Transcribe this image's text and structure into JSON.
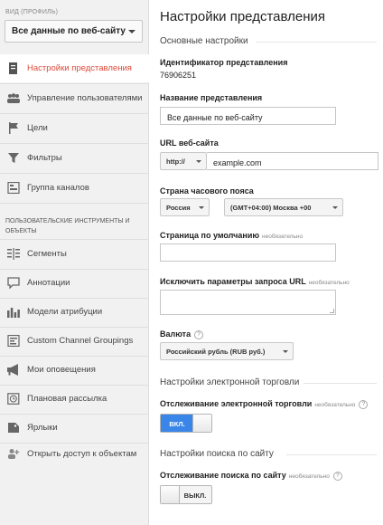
{
  "sidebar": {
    "view_label": "ВИД (ПРОФИЛЬ)",
    "view_select": "Все данные по веб-сайту",
    "items": [
      {
        "label": "Настройки представления",
        "icon": "settings-doc-icon",
        "active": true
      },
      {
        "label": "Управление пользователями",
        "icon": "users-icon"
      },
      {
        "label": "Цели",
        "icon": "flag-icon"
      },
      {
        "label": "Фильтры",
        "icon": "filter-icon"
      },
      {
        "label": "Группа каналов",
        "icon": "channel-group-icon"
      }
    ],
    "tools_heading": "ПОЛЬЗОВАТЕЛЬСКИЕ ИНСТРУМЕНТЫ И ОБЪЕКТЫ",
    "tools": [
      {
        "label": "Сегменты",
        "icon": "segments-icon"
      },
      {
        "label": "Аннотации",
        "icon": "annotation-icon"
      },
      {
        "label": "Модели атрибуции",
        "icon": "bar-chart-icon"
      },
      {
        "label": "Custom Channel Groupings",
        "icon": "custom-channel-icon"
      },
      {
        "label": "Мои оповещения",
        "icon": "megaphone-icon"
      },
      {
        "label": "Плановая рассылка",
        "icon": "clock-icon"
      },
      {
        "label": "Ярлыки",
        "icon": "shortcut-icon"
      },
      {
        "label": "Открыть доступ к объектам",
        "icon": "share-objects-icon"
      }
    ]
  },
  "main": {
    "title": "Настройки представления",
    "basic_heading": "Основные настройки",
    "view_id_label": "Идентификатор представления",
    "view_id_value": "76906251",
    "view_name_label": "Название представления",
    "view_name_value": "Все данные по веб-сайту",
    "url_label": "URL веб-сайта",
    "url_protocol": "http://",
    "url_value": "example.com",
    "timezone_label": "Страна часового пояса",
    "timezone_country": "Россия",
    "timezone_value": "(GMT+04:00) Москва +00",
    "default_page_label": "Страница по умолчанию",
    "optional": "необязательно",
    "exclude_params_label": "Исключить параметры запроса URL",
    "currency_label": "Валюта",
    "currency_value": "Российский рубль (RUB руб.)",
    "ecommerce_heading": "Настройки электронной торговли",
    "ecommerce_label": "Отслеживание электронной торговли",
    "ecommerce_toggle": "ВКЛ.",
    "site_search_heading": "Настройки поиска по сайту",
    "site_search_label": "Отслеживание поиска по сайту",
    "site_search_toggle": "ВЫКЛ.",
    "help_glyph": "?"
  },
  "colors": {
    "active": "#dd4b39",
    "toggle_on": "#3a86e8",
    "sidebar_bg": "#f1f1f1"
  }
}
